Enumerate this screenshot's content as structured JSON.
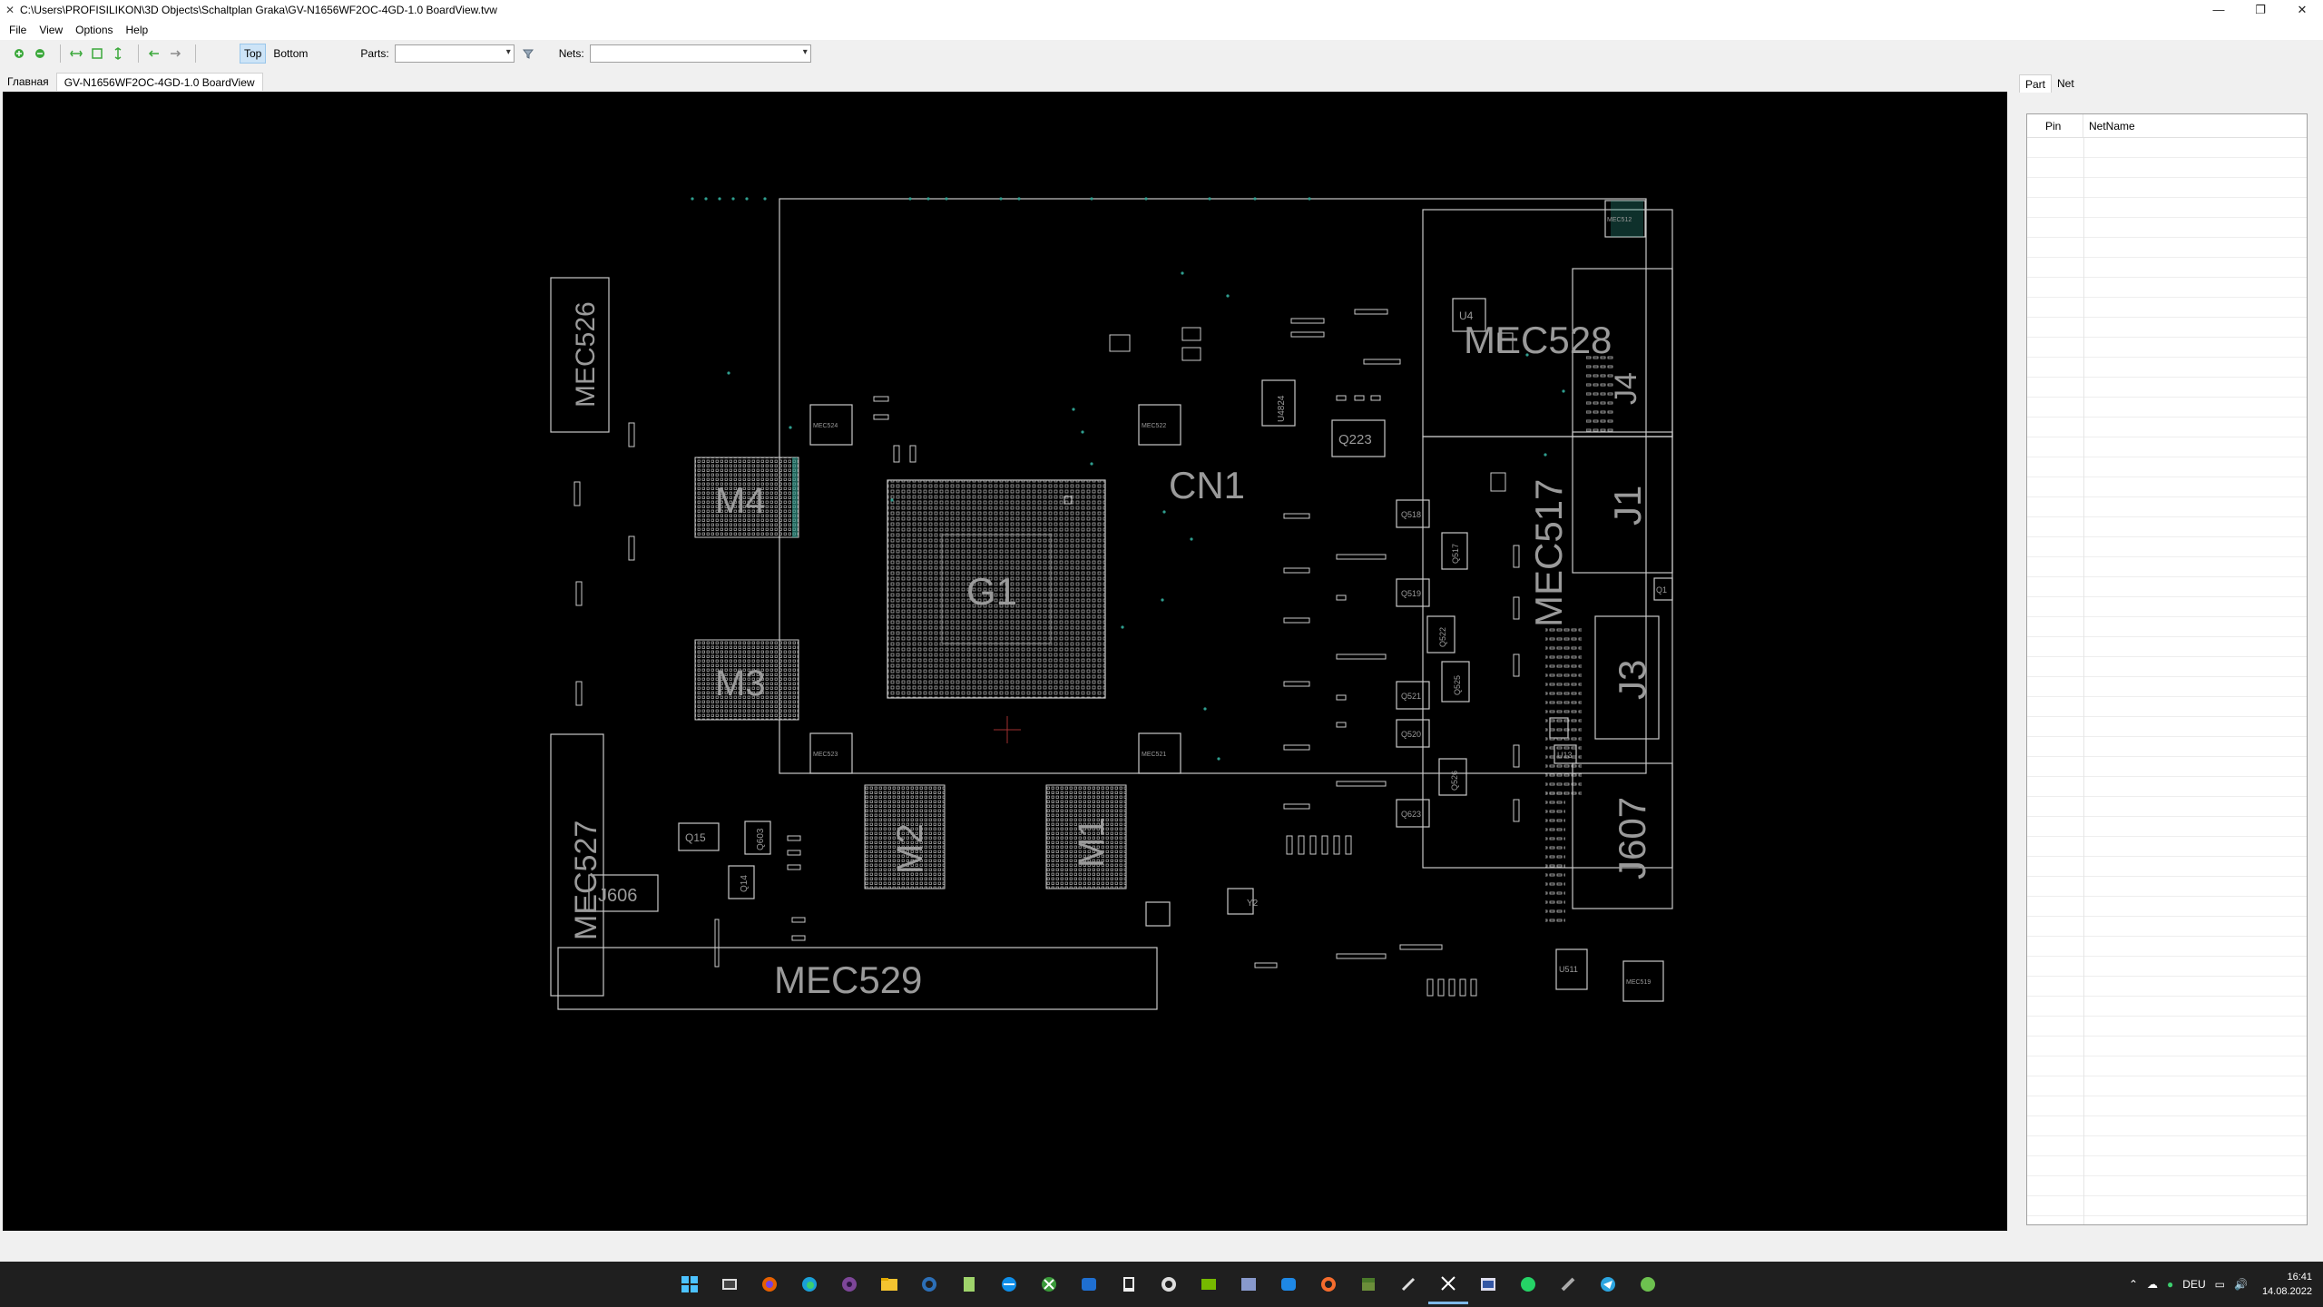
{
  "window": {
    "title": "C:\\Users\\PROFISILIKON\\3D Objects\\Schaltplan Graka\\GV-N1656WF2OC-4GD-1.0 BoardView.tvw",
    "minimize": "—",
    "restore": "❐",
    "close": "✕"
  },
  "menu": [
    "File",
    "View",
    "Options",
    "Help"
  ],
  "toolbar": {
    "top_label": "Top",
    "bottom_label": "Bottom",
    "parts_label": "Parts:",
    "parts_value": "",
    "nets_label": "Nets:",
    "nets_value": ""
  },
  "tabs": [
    "Главная",
    "GV-N1656WF2OC-4GD-1.0 BoardView"
  ],
  "board": {
    "labels": {
      "cn1": "CN1",
      "g1": "G1",
      "m1": "M1",
      "m2": "M2",
      "m3": "M3",
      "m4": "M4",
      "mec526": "MEC526",
      "mec527": "MEC527",
      "mec528": "MEC528",
      "mec529": "MEC529",
      "mec517": "MEC517",
      "j1": "J1",
      "j3": "J3",
      "j4": "J4",
      "j607": "J607",
      "j606": "J606",
      "q223": "Q223",
      "q15": "Q15",
      "q14": "Q14",
      "q603": "Q603",
      "u4": "U4",
      "u4824": "U4824",
      "q518": "Q518",
      "q519": "Q519",
      "q517": "Q517",
      "q521": "Q521",
      "q520": "Q520",
      "q522": "Q522",
      "q525": "Q525",
      "q526": "Q526",
      "q623": "Q623",
      "q1": "Q1",
      "u13": "U13",
      "u511": "U511",
      "y2": "Y2",
      "mec524": "MEC524",
      "mec522": "MEC522",
      "mec523": "MEC523",
      "mec521": "MEC521",
      "mec512": "MEC512",
      "mec519": "MEC519"
    }
  },
  "right_panel": {
    "tabs": [
      "Part",
      "Net"
    ],
    "columns": [
      "Pin",
      "NetName"
    ]
  },
  "taskbar": {
    "apps": [
      "windows-start",
      "task-view",
      "firefox",
      "edge",
      "tor",
      "explorer",
      "ccleaner",
      "notepad",
      "teamviewer",
      "xbox",
      "app-a",
      "epic",
      "chrome",
      "nvidia",
      "app-b",
      "app-c",
      "origin",
      "minecraft",
      "app-d",
      "boardviewer",
      "app-e",
      "whatsapp",
      "app-f",
      "telegram",
      "app-g"
    ],
    "lang": "DEU",
    "time": "16:41",
    "date": "14.08.2022"
  },
  "colors": {
    "board_bg": "#000000",
    "silkscreen": "#c8c8c8",
    "label": "#9a9a9a",
    "via": "#2f9e8f"
  }
}
